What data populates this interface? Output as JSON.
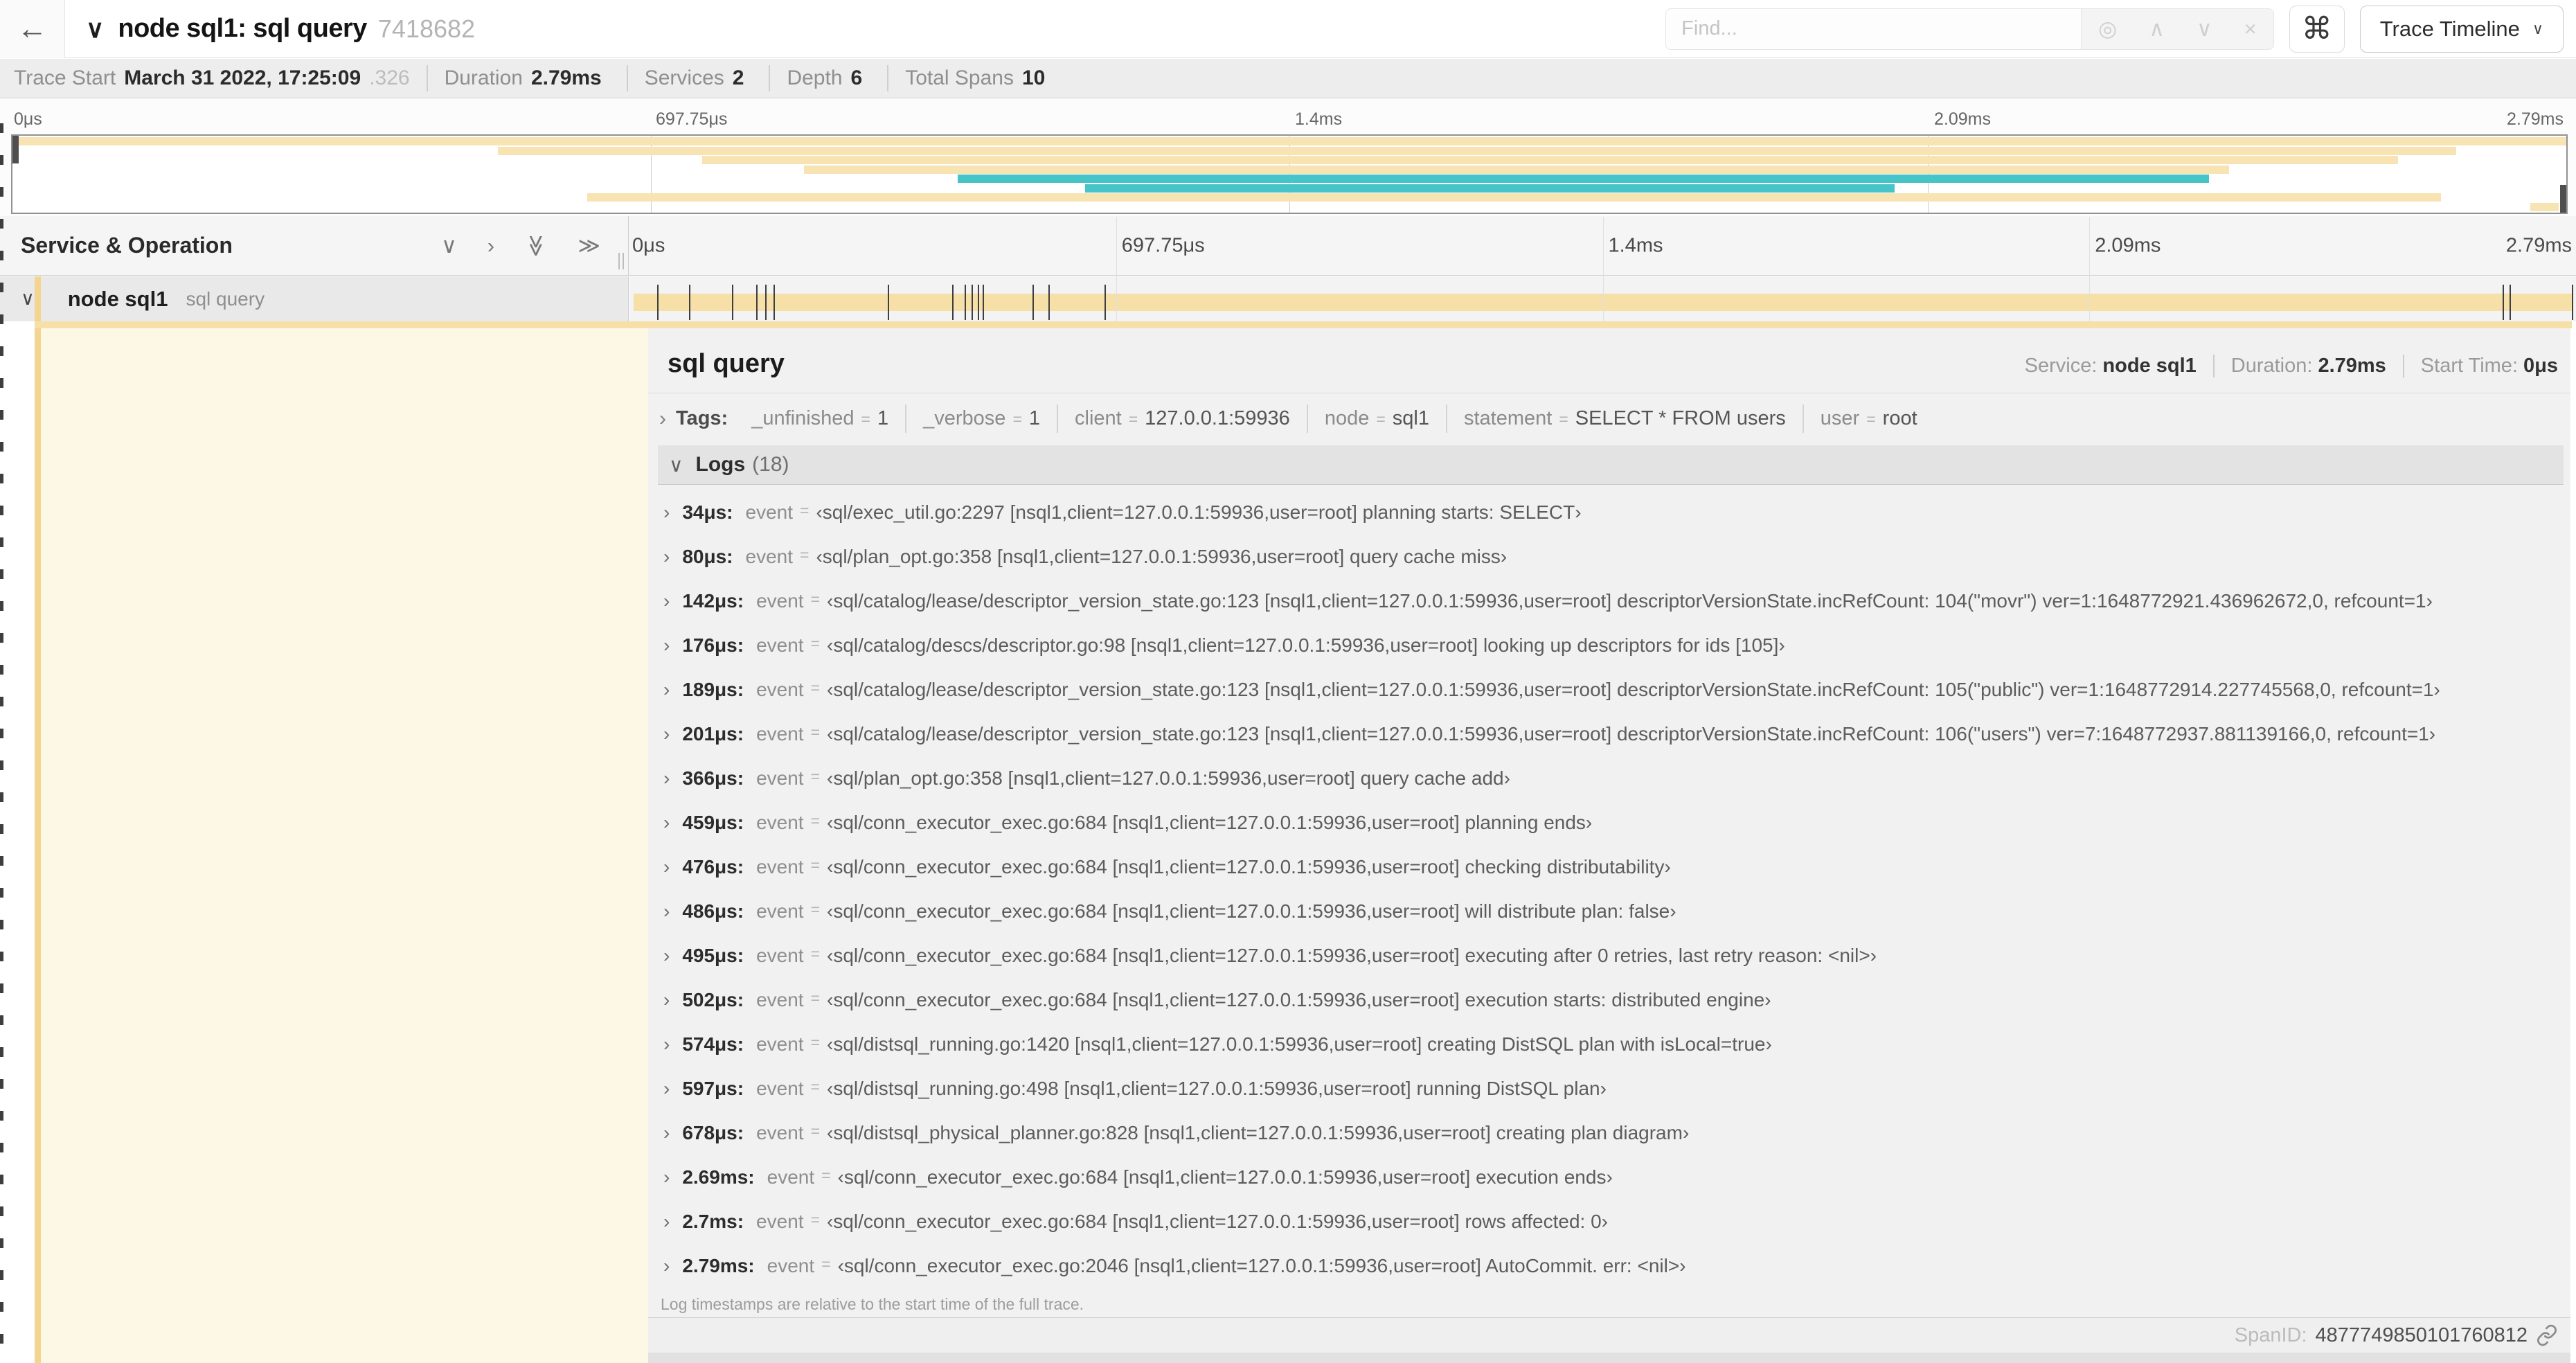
{
  "icons": {
    "back": "←",
    "chevron_down": "∨",
    "chevron_right": "›",
    "double_chevron": "≫",
    "locator": "◎",
    "up": "∧",
    "down": "∨",
    "close": "×",
    "command": "⌘"
  },
  "colors": {
    "tan": "#f8e3b3",
    "teal": "#45c5c8",
    "span_bar": "#f7dfa8",
    "stripe": "#f4d58f",
    "cream": "#fdf7e6"
  },
  "header": {
    "title": "node sql1: sql query",
    "trace_id": "7418682",
    "find_placeholder": "Find...",
    "view_selector": "Trace Timeline"
  },
  "summary": {
    "items": [
      {
        "label": "Trace Start",
        "value": "March 31 2022, 17:25:09",
        "suffix": ".326"
      },
      {
        "label": "Duration",
        "value": "2.79ms"
      },
      {
        "label": "Services",
        "value": "2"
      },
      {
        "label": "Depth",
        "value": "6"
      },
      {
        "label": "Total Spans",
        "value": "10"
      }
    ]
  },
  "trace": {
    "duration_us": 2790
  },
  "timeline": {
    "ticks": [
      {
        "label": "0μs",
        "f": 0
      },
      {
        "label": "697.75μs",
        "f": 0.25
      },
      {
        "label": "1.4ms",
        "f": 0.5
      },
      {
        "label": "2.09ms",
        "f": 0.75
      },
      {
        "label": "2.79ms",
        "f": 1
      }
    ]
  },
  "minimap": {
    "bars": [
      {
        "lane": 0,
        "start": 0.0,
        "end": 1.0,
        "color": "tan"
      },
      {
        "lane": 1,
        "start": 0.19,
        "end": 0.957,
        "color": "tan"
      },
      {
        "lane": 2,
        "start": 0.27,
        "end": 0.934,
        "color": "tan"
      },
      {
        "lane": 3,
        "start": 0.31,
        "end": 0.868,
        "color": "tan"
      },
      {
        "lane": 4,
        "start": 0.37,
        "end": 0.86,
        "color": "teal"
      },
      {
        "lane": 5,
        "start": 0.42,
        "end": 0.737,
        "color": "teal"
      },
      {
        "lane": 6,
        "start": 0.225,
        "end": 0.951,
        "color": "tan"
      },
      {
        "lane": 7,
        "start": 0.986,
        "end": 0.997,
        "color": "tan"
      }
    ]
  },
  "columns": {
    "left_header": "Service & Operation"
  },
  "span_row": {
    "service": "node sql1",
    "operation": "sql query"
  },
  "detail": {
    "operation": "sql query",
    "meta": [
      {
        "label": "Service:",
        "value": "node sql1"
      },
      {
        "label": "Duration:",
        "value": "2.79ms"
      },
      {
        "label": "Start Time:",
        "value": "0μs"
      }
    ],
    "tags_label": "Tags:",
    "tag_eq": "=",
    "tags": [
      {
        "key": "_unfinished",
        "value": "1"
      },
      {
        "key": "_verbose",
        "value": "1"
      },
      {
        "key": "client",
        "value": "127.0.0.1:59936"
      },
      {
        "key": "node",
        "value": "sql1"
      },
      {
        "key": "statement",
        "value": "SELECT * FROM users"
      },
      {
        "key": "user",
        "value": "root"
      }
    ],
    "logs_label": "Logs",
    "logs_count": "(18)",
    "log_event_key": "event",
    "log_eq": "=",
    "logs": [
      {
        "t": 34,
        "time": "34μs:",
        "event": "‹sql/exec_util.go:2297 [nsql1,client=127.0.0.1:59936,user=root] planning starts: SELECT›"
      },
      {
        "t": 80,
        "time": "80μs:",
        "event": "‹sql/plan_opt.go:358 [nsql1,client=127.0.0.1:59936,user=root] query cache miss›"
      },
      {
        "t": 142,
        "time": "142μs:",
        "event": "‹sql/catalog/lease/descriptor_version_state.go:123 [nsql1,client=127.0.0.1:59936,user=root] descriptorVersionState.incRefCount: 104(\"movr\") ver=1:1648772921.436962672,0, refcount=1›"
      },
      {
        "t": 176,
        "time": "176μs:",
        "event": "‹sql/catalog/descs/descriptor.go:98 [nsql1,client=127.0.0.1:59936,user=root] looking up descriptors for ids [105]›"
      },
      {
        "t": 189,
        "time": "189μs:",
        "event": "‹sql/catalog/lease/descriptor_version_state.go:123 [nsql1,client=127.0.0.1:59936,user=root] descriptorVersionState.incRefCount: 105(\"public\") ver=1:1648772914.227745568,0, refcount=1›"
      },
      {
        "t": 201,
        "time": "201μs:",
        "event": "‹sql/catalog/lease/descriptor_version_state.go:123 [nsql1,client=127.0.0.1:59936,user=root] descriptorVersionState.incRefCount: 106(\"users\") ver=7:1648772937.881139166,0, refcount=1›"
      },
      {
        "t": 366,
        "time": "366μs:",
        "event": "‹sql/plan_opt.go:358 [nsql1,client=127.0.0.1:59936,user=root] query cache add›"
      },
      {
        "t": 459,
        "time": "459μs:",
        "event": "‹sql/conn_executor_exec.go:684 [nsql1,client=127.0.0.1:59936,user=root] planning ends›"
      },
      {
        "t": 476,
        "time": "476μs:",
        "event": "‹sql/conn_executor_exec.go:684 [nsql1,client=127.0.0.1:59936,user=root] checking distributability›"
      },
      {
        "t": 486,
        "time": "486μs:",
        "event": "‹sql/conn_executor_exec.go:684 [nsql1,client=127.0.0.1:59936,user=root] will distribute plan: false›"
      },
      {
        "t": 495,
        "time": "495μs:",
        "event": "‹sql/conn_executor_exec.go:684 [nsql1,client=127.0.0.1:59936,user=root] executing after 0 retries, last retry reason: <nil>›"
      },
      {
        "t": 502,
        "time": "502μs:",
        "event": "‹sql/conn_executor_exec.go:684 [nsql1,client=127.0.0.1:59936,user=root] execution starts: distributed engine›"
      },
      {
        "t": 574,
        "time": "574μs:",
        "event": "‹sql/distsql_running.go:1420 [nsql1,client=127.0.0.1:59936,user=root] creating DistSQL plan with isLocal=true›"
      },
      {
        "t": 597,
        "time": "597μs:",
        "event": "‹sql/distsql_running.go:498 [nsql1,client=127.0.0.1:59936,user=root] running DistSQL plan›"
      },
      {
        "t": 678,
        "time": "678μs:",
        "event": "‹sql/distsql_physical_planner.go:828 [nsql1,client=127.0.0.1:59936,user=root] creating plan diagram›"
      },
      {
        "t": 2690,
        "time": "2.69ms:",
        "event": "‹sql/conn_executor_exec.go:684 [nsql1,client=127.0.0.1:59936,user=root] execution ends›"
      },
      {
        "t": 2700,
        "time": "2.7ms:",
        "event": "‹sql/conn_executor_exec.go:684 [nsql1,client=127.0.0.1:59936,user=root] rows affected: 0›"
      },
      {
        "t": 2790,
        "time": "2.79ms:",
        "event": "‹sql/conn_executor_exec.go:2046 [nsql1,client=127.0.0.1:59936,user=root] AutoCommit. err: <nil>›"
      }
    ],
    "logs_footnote": "Log timestamps are relative to the start time of the full trace.",
    "span_id_label": "SpanID:",
    "span_id": "4877749850101760812"
  }
}
